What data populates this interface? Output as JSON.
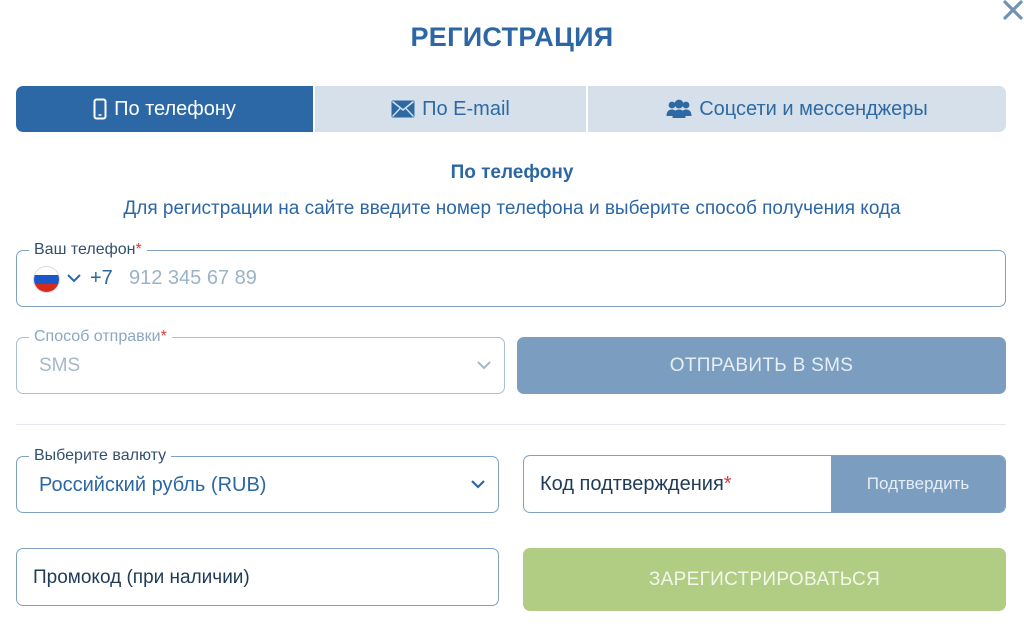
{
  "dialog": {
    "title": "РЕГИСТРАЦИЯ",
    "close_icon": "close-icon"
  },
  "tabs": [
    {
      "label": "По телефону",
      "icon": "smartphone-icon",
      "active": true
    },
    {
      "label": "По E-mail",
      "icon": "envelope-icon",
      "active": false
    },
    {
      "label": "Соцсети и мессенджеры",
      "icon": "users-icon",
      "active": false
    }
  ],
  "section": {
    "title": "По телефону",
    "description": "Для регистрации на сайте введите номер телефона и выберите способ получения кода"
  },
  "phone": {
    "label": "Ваш телефон",
    "required_mark": "*",
    "country_icon": "russia-flag-icon",
    "country_code": "+7",
    "value": "",
    "placeholder": "912 345 67 89"
  },
  "send_method": {
    "label": "Способ отправки",
    "required_mark": "*",
    "value": "SMS",
    "disabled": true
  },
  "send_button": {
    "label": "ОТПРАВИТЬ В SMS"
  },
  "currency": {
    "label": "Выберите валюту",
    "value": "Российский рубль (RUB)"
  },
  "confirmation": {
    "label": "Код подтверждения",
    "required_mark": "*",
    "button_label": "Подтвердить"
  },
  "promo": {
    "label": "Промокод (при наличии)"
  },
  "register_button": {
    "label": "ЗАРЕГИСТРИРОВАТЬСЯ"
  },
  "colors": {
    "primary": "#2c68a6",
    "tab_bg": "#d5e0ea",
    "button_disabled": "#7b9ec0",
    "register_button": "#b1cd84",
    "required": "#e03a3a"
  }
}
